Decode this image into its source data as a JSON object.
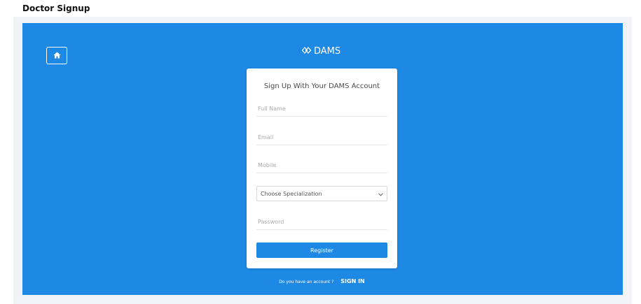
{
  "page": {
    "title": "Doctor Signup"
  },
  "colors": {
    "panel_blue": "#1e88e5",
    "outer_bg": "#f1f3f6",
    "card_bg": "#ffffff"
  },
  "header": {
    "home_icon": "home-icon",
    "brand_icon": "diamond-logo-icon",
    "brand_name": "DAMS"
  },
  "form": {
    "heading": "Sign Up With Your DAMS Account",
    "full_name_placeholder": "Full Name",
    "email_placeholder": "Email",
    "mobile_placeholder": "Mobile",
    "specialization_selected": "Choose Specialization",
    "password_placeholder": "Password",
    "register_label": "Register"
  },
  "footer": {
    "prompt": "Do you have an account ?",
    "signin_label": "SIGN IN"
  }
}
